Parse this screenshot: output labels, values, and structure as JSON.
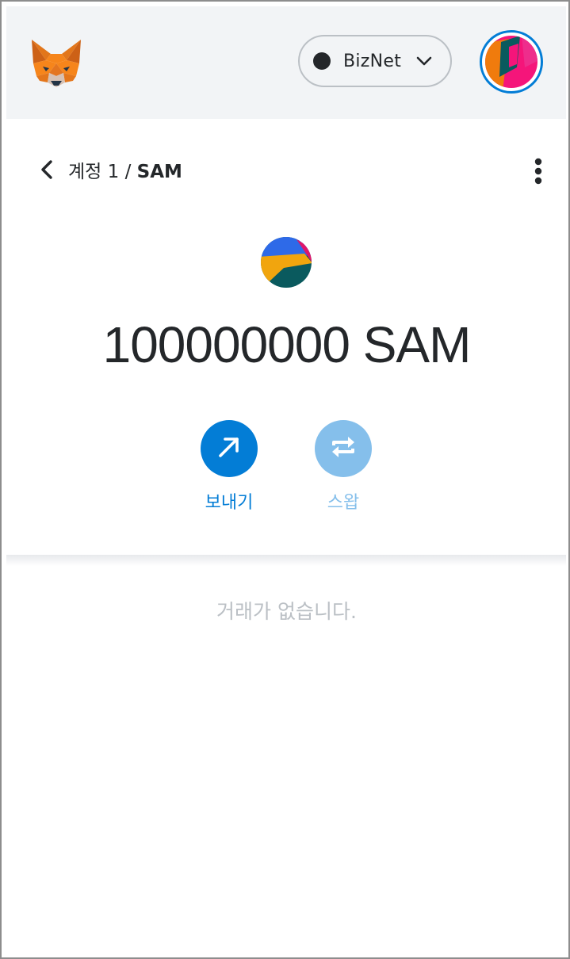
{
  "header": {
    "logo_icon": "metamask-fox-icon",
    "network": {
      "name": "BizNet",
      "dot_color": "#24272a",
      "icon": "chevron-down-icon"
    },
    "account_avatar": {
      "icon": "account-identicon",
      "ring_color": "#037dd6"
    }
  },
  "asset_nav": {
    "back_icon": "chevron-left-icon",
    "account_name": "계정 1",
    "separator": " / ",
    "token_symbol": "SAM",
    "menu_icon": "kebab-menu-icon"
  },
  "token": {
    "icon": "token-identicon",
    "balance_text": "100000000 SAM"
  },
  "actions": {
    "send": {
      "label": "보내기",
      "icon": "arrow-up-right-icon",
      "color": "#037dd6"
    },
    "swap": {
      "label": "스왑",
      "icon": "swap-arrows-icon",
      "color": "#85bfeb"
    }
  },
  "transactions": {
    "empty_message": "거래가 없습니다."
  }
}
